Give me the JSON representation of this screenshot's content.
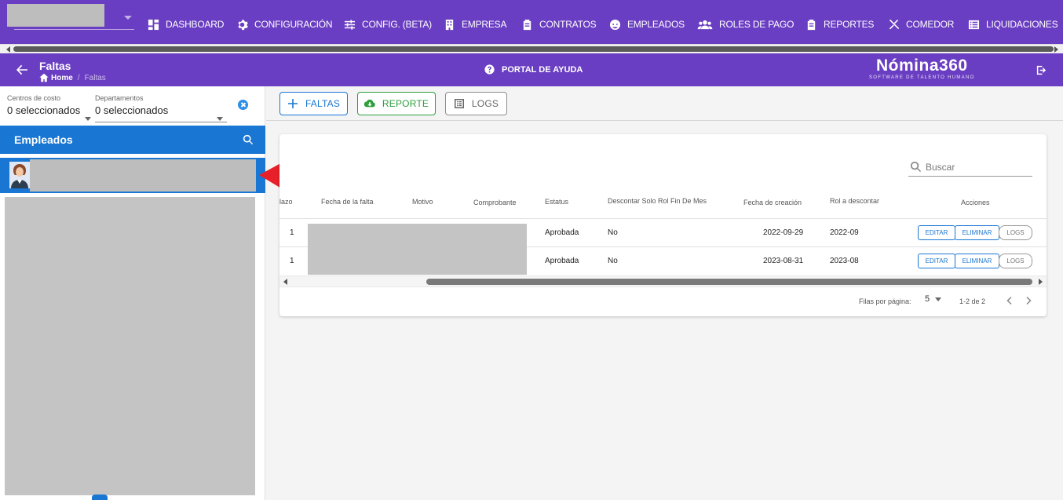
{
  "nav": {
    "items": [
      {
        "label": "DASHBOARD",
        "icon": "dashboard-icon"
      },
      {
        "label": "CONFIGURACIÓN",
        "icon": "gear-icon"
      },
      {
        "label": "CONFIG. (BETA)",
        "icon": "sliders-icon"
      },
      {
        "label": "EMPRESA",
        "icon": "building-icon"
      },
      {
        "label": "CONTRATOS",
        "icon": "clipboard-icon"
      },
      {
        "label": "EMPLEADOS",
        "icon": "face-icon"
      },
      {
        "label": "ROLES DE PAGO",
        "icon": "people-icon"
      },
      {
        "label": "REPORTES",
        "icon": "clipboard-report-icon"
      },
      {
        "label": "COMEDOR",
        "icon": "utensils-icon"
      },
      {
        "label": "LIQUIDACIONES",
        "icon": "list-icon"
      }
    ]
  },
  "header": {
    "title": "Faltas",
    "breadcrumb_home": "Home",
    "breadcrumb_current": "Faltas",
    "help_label": "PORTAL DE AYUDA",
    "brand_name": "Nómina360",
    "brand_tagline": "SOFTWARE DE TALENTO HUMANO"
  },
  "filters": {
    "cost_centers_label": "Centros de costo",
    "cost_centers_value": "0 seleccionados",
    "departments_label": "Departamentos",
    "departments_value": "0 seleccionados"
  },
  "employees": {
    "header": "Empleados"
  },
  "toolbar": {
    "add_label": "FALTAS",
    "report_label": "REPORTE",
    "logs_label": "LOGS"
  },
  "table": {
    "search_placeholder": "Buscar",
    "columns": [
      "lazo",
      "Fecha de la falta",
      "Motivo",
      "Comprobante",
      "Estatus",
      "Descontar Solo Rol Fin De Mes",
      "Fecha de creación",
      "Rol a descontar",
      "Acciones"
    ],
    "rows": [
      {
        "plazo": "1",
        "estatus": "Aprobada",
        "descontar": "No",
        "fecha_creacion": "2022-09-29",
        "rol": "2022-09"
      },
      {
        "plazo": "1",
        "estatus": "Aprobada",
        "descontar": "No",
        "fecha_creacion": "2023-08-31",
        "rol": "2023-08"
      }
    ],
    "actions": {
      "edit": "EDITAR",
      "delete": "ELIMINAR",
      "logs": "LOGS"
    },
    "rows_per_page_label": "Filas por página:",
    "rows_per_page_value": "5",
    "range_text": "1-2 de 2"
  },
  "colors": {
    "nav_purple": "#6a3ec2",
    "primary_blue": "#1976d2",
    "report_green": "#2e9e3c",
    "annotation_red": "#e8202a"
  }
}
